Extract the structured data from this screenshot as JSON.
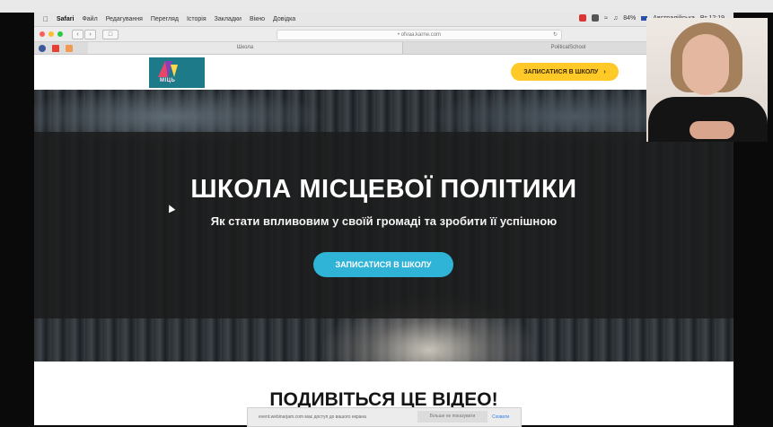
{
  "menubar": {
    "app": "Safari",
    "items": [
      "Файл",
      "Редагування",
      "Перегляд",
      "Історія",
      "Закладки",
      "Вікно",
      "Довідка"
    ],
    "battery": "84%",
    "input_source": "Австралійська",
    "clock": "Вт 12:19"
  },
  "browser": {
    "url": "ofvaa.karne.com",
    "tabs": [
      "Школа",
      "PoliticalSchool"
    ]
  },
  "site": {
    "logo_text": "МІЦЬ",
    "header_cta": "ЗАПИСАТИСЯ В ШКОЛУ",
    "header_cta_icon": "chevron-right-icon",
    "hero_title": "ШКОЛА МІСЦЕВОЇ ПОЛІТИКИ",
    "hero_subtitle": "Як стати впливовим у своїй громаді та зробити її успішною",
    "hero_cta": "ЗАПИСАТИСЯ В ШКОЛУ",
    "section_title": "ПОДИВІТЬСЯ ЦЕ ВІДЕО!"
  },
  "notice": {
    "text": "event.webinarjam.com має доступ до вашого екрана",
    "hide_button": "Більше не показувати",
    "ok_button": "Сховати"
  },
  "colors": {
    "header_cta_bg": "#ffc928",
    "hero_cta_bg": "#2fb3d6",
    "logo_bg": "#1d7a89"
  }
}
